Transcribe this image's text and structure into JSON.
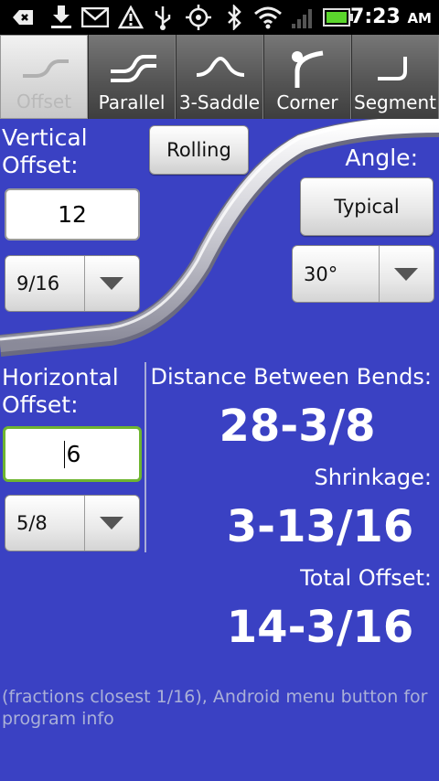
{
  "status_bar": {
    "icons": [
      "usb-debug-icon",
      "download-icon",
      "gmail-icon",
      "warning-icon",
      "usb-icon",
      "gps-icon",
      "bluetooth-icon",
      "wifi-icon",
      "signal-icon",
      "battery-icon"
    ],
    "time": "7:23",
    "ampm": "AM"
  },
  "tabs": [
    {
      "label": "Offset",
      "active": true
    },
    {
      "label": "Parallel",
      "active": false
    },
    {
      "label": "3-Saddle",
      "active": false
    },
    {
      "label": "Corner",
      "active": false
    },
    {
      "label": "Segment",
      "active": false
    }
  ],
  "vertical": {
    "label_line1": "Vertical",
    "label_line2": "Offset:",
    "value": "12",
    "fraction": "9/16"
  },
  "rolling_button": "Rolling",
  "angle": {
    "label": "Angle:",
    "typical_button": "Typical",
    "value": "30°"
  },
  "horizontal": {
    "label_line1": "Horizontal",
    "label_line2": "Offset:",
    "value": "6",
    "fraction": "5/8"
  },
  "results": {
    "distance_label": "Distance Between Bends:",
    "distance_value": "28-3/8",
    "shrinkage_label": "Shrinkage:",
    "shrinkage_value": "3-13/16",
    "total_label": "Total Offset:",
    "total_value": "14-3/16"
  },
  "footer": "(fractions closest 1/16), Android menu button for program info",
  "colors": {
    "background": "#3a41c3",
    "focus_border": "#6eb530"
  }
}
